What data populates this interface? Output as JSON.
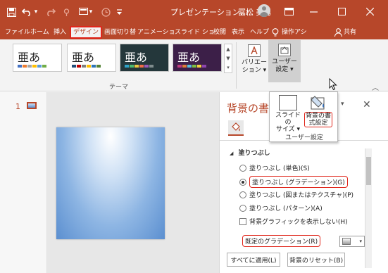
{
  "qat": {
    "save_icon": "save-icon",
    "undo_icon": "undo-icon",
    "undo_dropdown": "▾",
    "redo_icon": "redo-icon",
    "touch_mode_icon": "touch-mode-icon",
    "slide_icon": "new-slide-icon",
    "slide_dropdown": "▾",
    "recent_icon": "recent-icon",
    "customize_icon": "customize-qat-icon"
  },
  "window": {
    "title": "プレゼンテーション…",
    "user_name": "冨松 美男",
    "ribbon_display_icon": "ribbon-display-icon",
    "minimize_icon": "minimize-icon",
    "maximize_icon": "maximize-icon",
    "close_icon": "close-icon"
  },
  "tabs": {
    "file": "ファイル",
    "home": "ホーム",
    "insert": "挿入",
    "design": "デザイン",
    "transitions": "画面切り替",
    "animations": "アニメーショ",
    "slideshow": "スライド ショ",
    "review": "校閲",
    "view": "表示",
    "help": "ヘルプ",
    "tellme_icon": "lightbulb-icon",
    "tellme": "操作アシ",
    "share_icon": "share-icon",
    "share": "共有"
  },
  "ribbon": {
    "themes": [
      {
        "sample": "亜あ",
        "bg": "#ffffff",
        "fg": "#222222",
        "accent": [
          "#4472c4",
          "#ed7d31",
          "#a5a5a5",
          "#ffc000",
          "#5b9bd5",
          "#70ad47"
        ]
      },
      {
        "sample": "亜あ",
        "bg": "#ffffff",
        "fg": "#222222",
        "accent": [
          "#1f4e79",
          "#c00000",
          "#7f7f7f",
          "#ffc000",
          "#2e75b6",
          "#548235"
        ]
      },
      {
        "sample": "亜あ",
        "bg": "#24373b",
        "fg": "#ffffff",
        "accent": [
          "#2fa3c8",
          "#4bbb6f",
          "#e8c940",
          "#ef6c49",
          "#9b59b6",
          "#7f8c8d"
        ]
      },
      {
        "sample": "亜あ",
        "bg": "#3c1f48",
        "fg": "#ffffff",
        "accent": [
          "#c0397d",
          "#e07b39",
          "#5bc0de",
          "#7bc043",
          "#f4d03f",
          "#8e44ad"
        ]
      }
    ],
    "themes_group_label": "テーマ",
    "gallery_up": "▲",
    "gallery_down": "▼",
    "gallery_more": "▾",
    "variants_label": "バリエー\nション ▾",
    "variants_icon": "variants-icon",
    "customize_label": "ユーザー\n設定 ▾",
    "customize_icon": "customize-icon",
    "collapse_ribbon": "︿"
  },
  "popup": {
    "slide_size_label": "スライドの\nサイズ ▾",
    "slide_size_icon": "slide-size-icon",
    "format_bg_label": "背景の書\n式設定",
    "format_bg_icon": "format-background-icon",
    "group_label": "ユーザー設定",
    "cursor_icon": "mouse-pointer-icon"
  },
  "thumbnails": {
    "slide_number": "1"
  },
  "pane": {
    "title": "背景の書",
    "menu_icon": "▾",
    "close_icon": "✕",
    "fill_icon": "paint-bucket-icon",
    "section_arrow": "◢",
    "section_label": "塗りつぶし",
    "options": [
      {
        "label": "塗りつぶし (単色)(S)",
        "selected": false
      },
      {
        "label": "塗りつぶし (グラデーション)(G)",
        "selected": true
      },
      {
        "label": "塗りつぶし (図またはテクスチャ)(P)",
        "selected": false
      },
      {
        "label": "塗りつぶし (パターン)(A)",
        "selected": false
      }
    ],
    "hide_bg_graphics": "背景グラフィックを表示しない(H)",
    "preset_gradient": "既定のグラデーション(R)",
    "preset_dropdown": "▾",
    "apply_all": "すべてに適用(L)",
    "reset_bg": "背景のリセット(B)"
  }
}
